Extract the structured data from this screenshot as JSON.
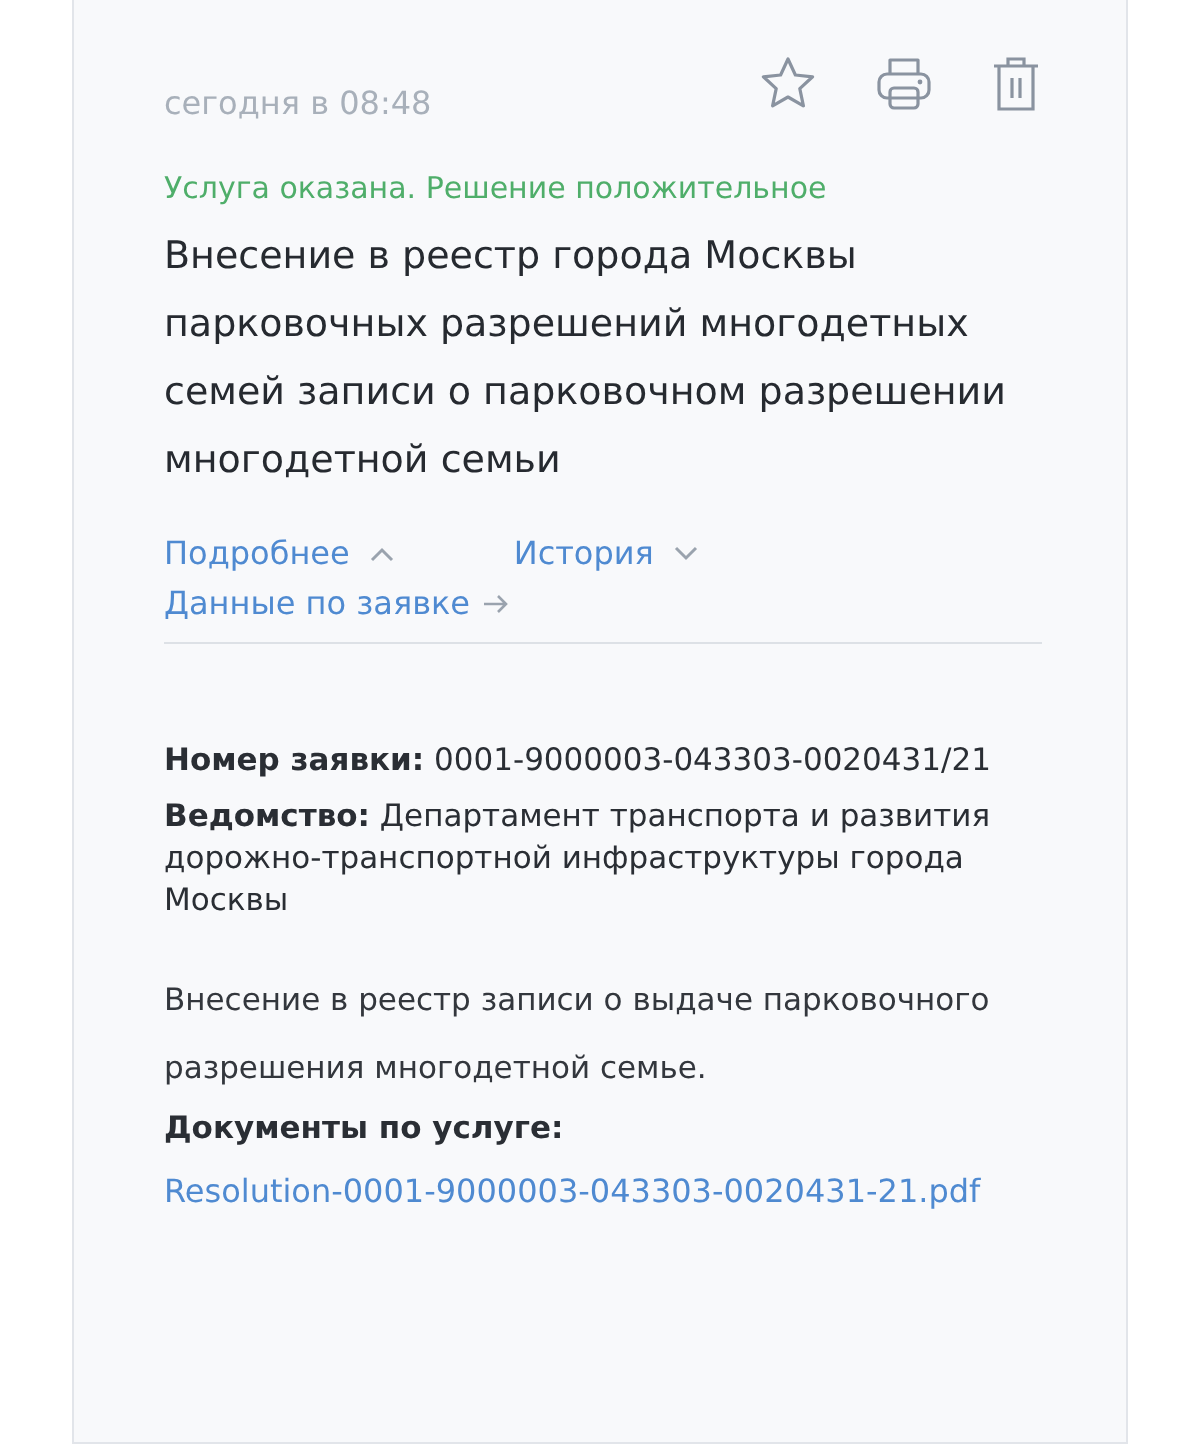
{
  "card": {
    "date": "сегодня в 08:48",
    "favorite": false,
    "status": "Услуга оказана. Решение положительное",
    "title": "Внесение в реестр города Москвы парковочных разрешений многодетных семей записи о парковочном разрешении многодетной семьи",
    "toggles": [
      {
        "label": "Подробнее",
        "expanded": true
      },
      {
        "label": "История",
        "expanded": false
      }
    ],
    "data_link": "Данные по заявке",
    "fields": [
      {
        "kind": "number",
        "label": "Номер заявки:",
        "value": "0001-9000003-043303-0020431/21"
      },
      {
        "kind": "agency",
        "label": "Ведомство:",
        "value": "Департамент транспорта и развития дорожно-транспортной инфраструктуры города Москвы"
      }
    ],
    "description": "Внесение в реестр записи о выдаче парковочного разрешения многодетной семье.",
    "documents_label": "Документы по услуге:",
    "documents": [
      "Resolution-0001-9000003-043303-0020431-21.pdf"
    ]
  }
}
